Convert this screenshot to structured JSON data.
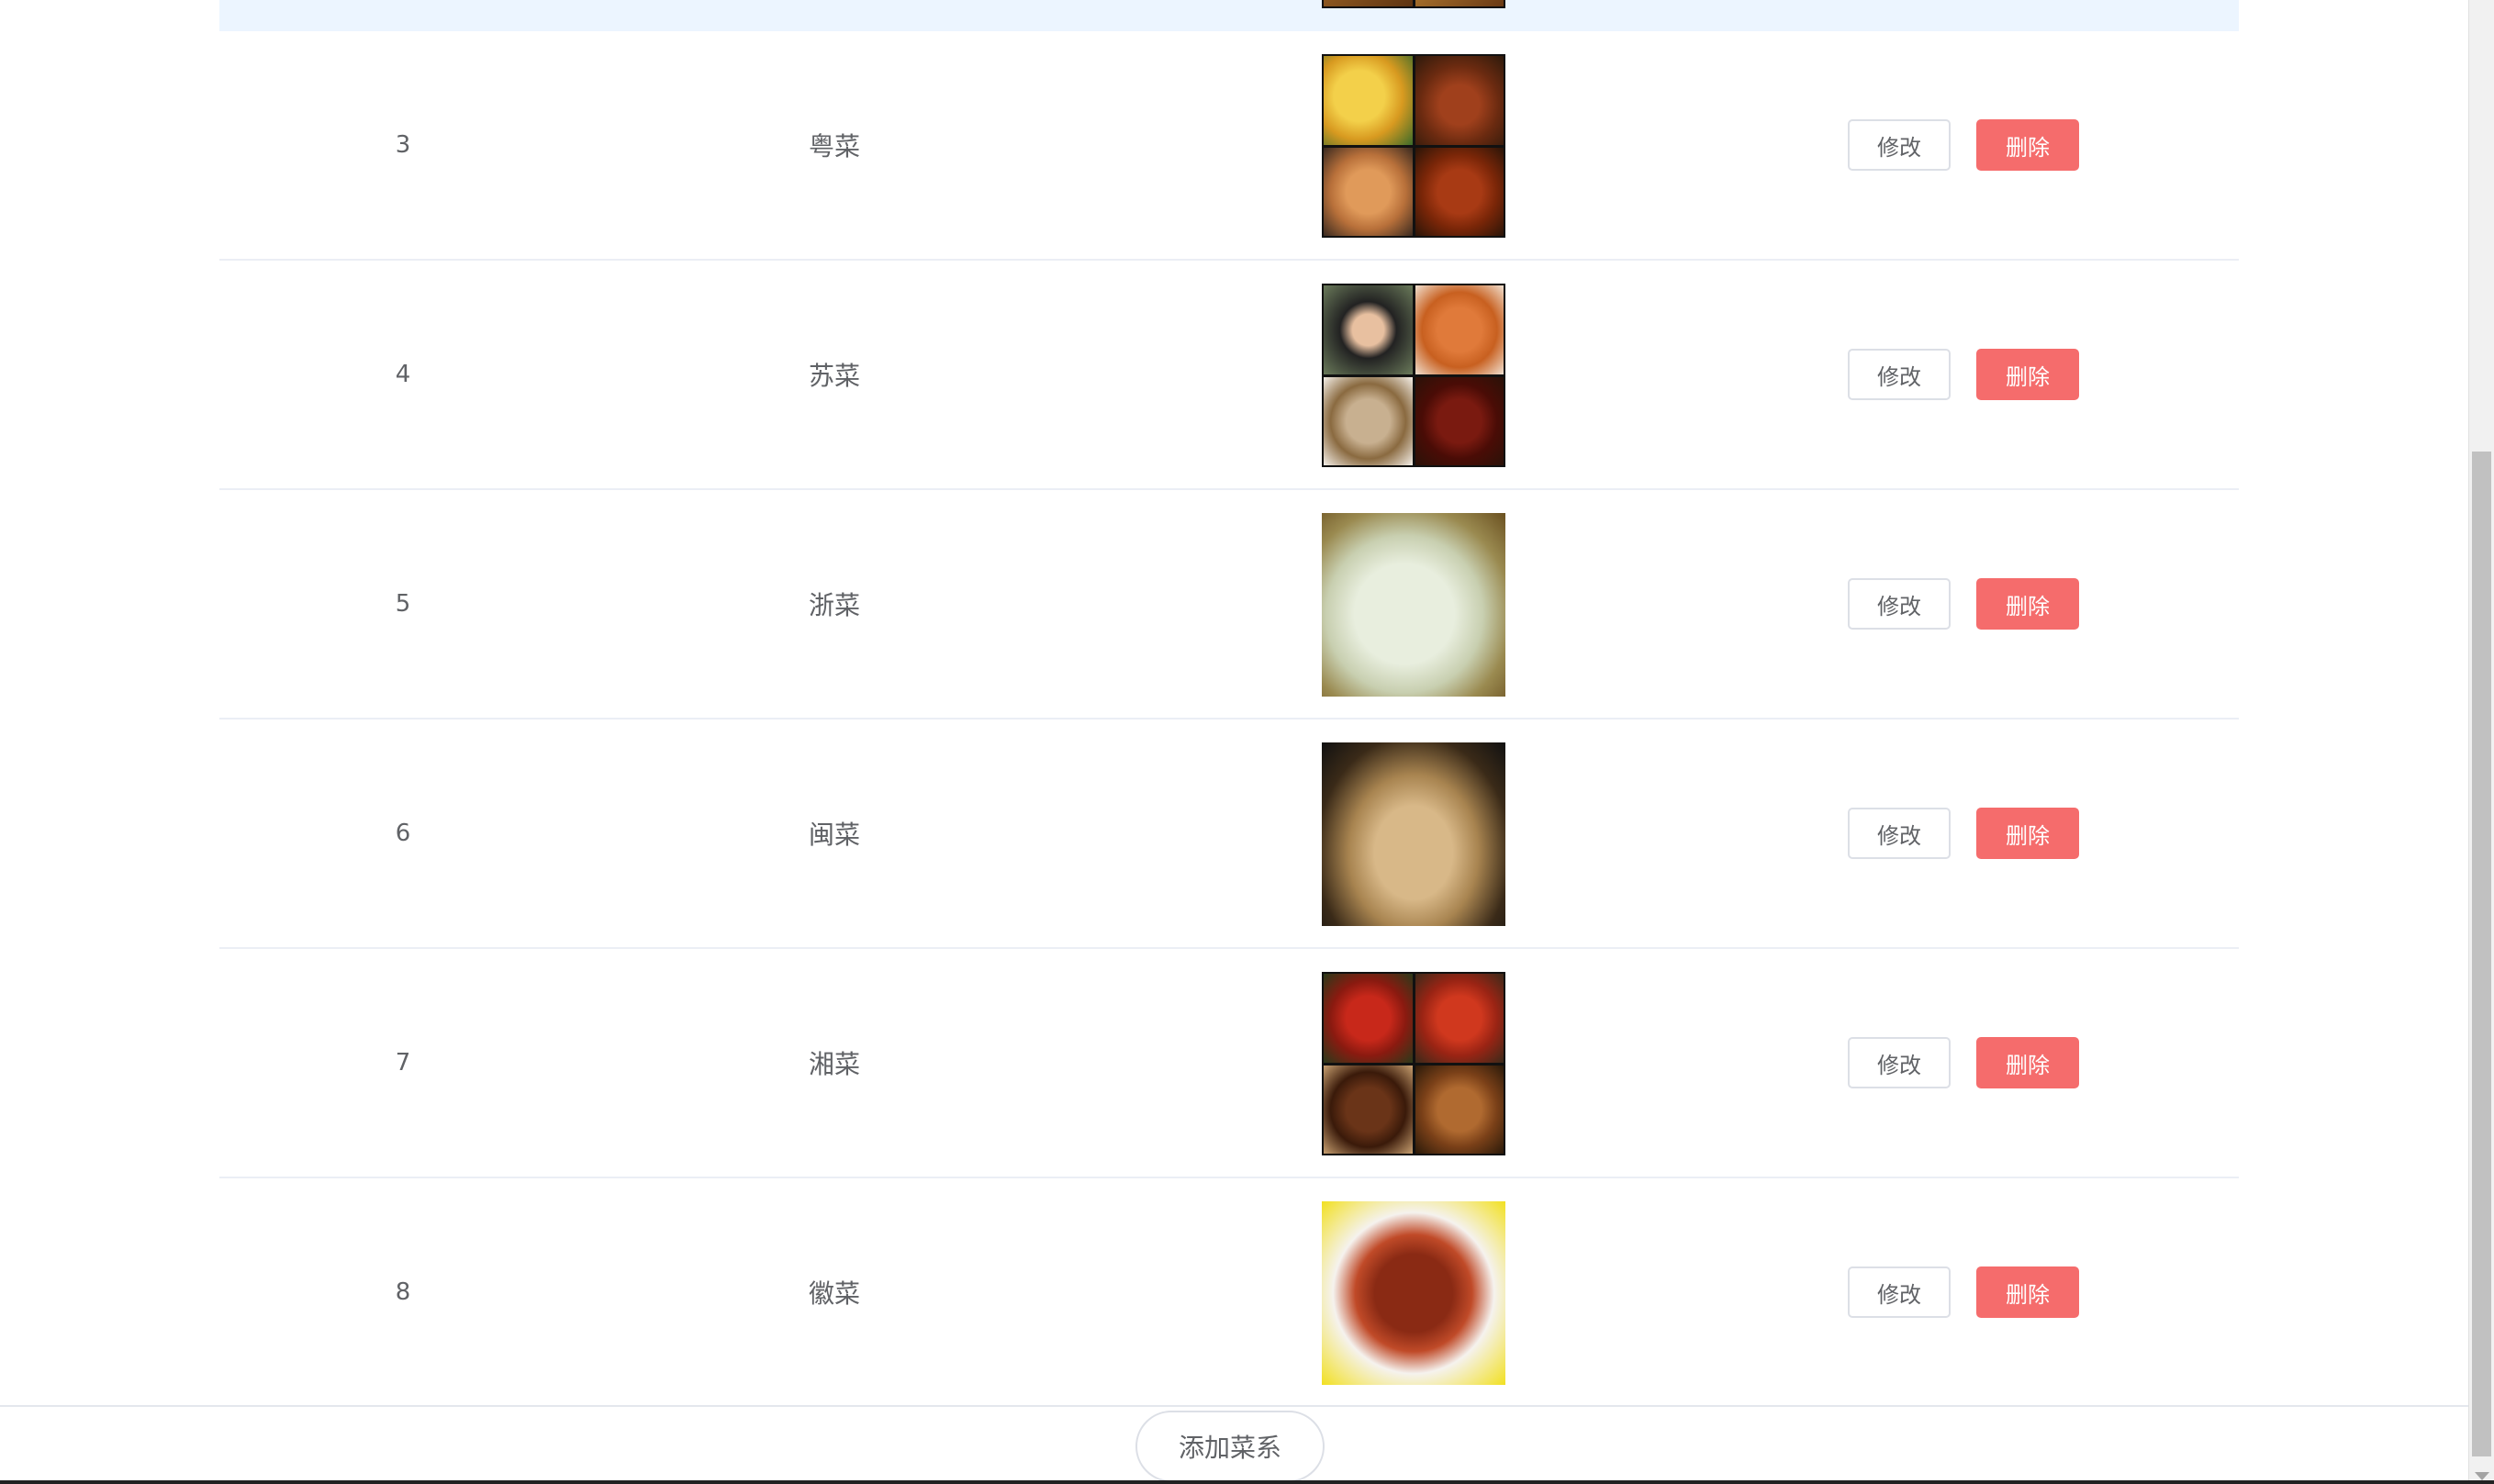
{
  "table": {
    "rows": [
      {
        "id": "3",
        "name": "粤菜",
        "image_alt": "粤菜 dish photo collage"
      },
      {
        "id": "4",
        "name": "苏菜",
        "image_alt": "苏菜 dish photo collage"
      },
      {
        "id": "5",
        "name": "浙菜",
        "image_alt": "浙菜 dish photo"
      },
      {
        "id": "6",
        "name": "闽菜",
        "image_alt": "闽菜 dish photo"
      },
      {
        "id": "7",
        "name": "湘菜",
        "image_alt": "湘菜 dish photo collage"
      },
      {
        "id": "8",
        "name": "徽菜",
        "image_alt": "徽菜 dish photo"
      }
    ],
    "edit_label": "修改",
    "delete_label": "删除"
  },
  "footer": {
    "add_label": "添加菜系"
  },
  "colors": {
    "delete_button": "#f56c6c",
    "highlight_row": "#ecf5ff",
    "row_border": "#ebeef5",
    "text": "#606266"
  }
}
